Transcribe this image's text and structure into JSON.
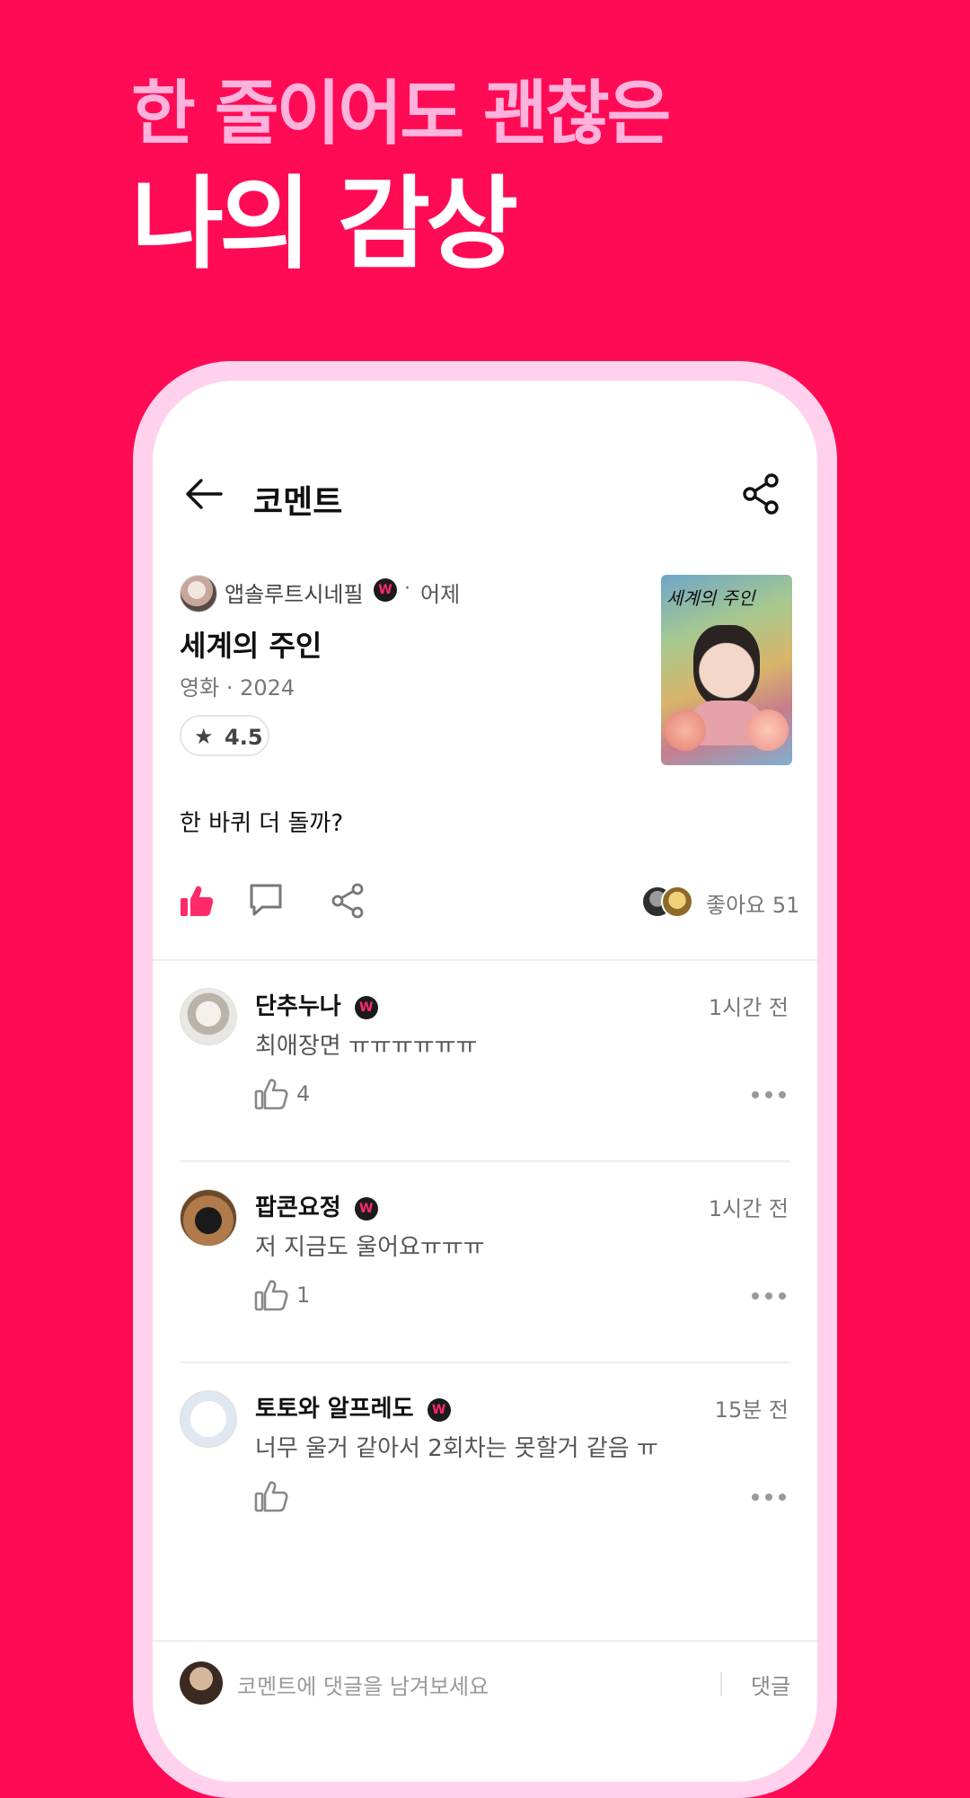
{
  "headline": {
    "line1": "한 줄이어도 괜찮은",
    "line2": "나의 감상"
  },
  "appbar": {
    "title": "코멘트",
    "back_icon": "arrow-left-icon",
    "share_icon": "share-icon"
  },
  "post": {
    "author": "앱솔루트시네필",
    "badge": "W",
    "separator": "·",
    "time": "어제",
    "title": "세계의 주인",
    "category": "영화",
    "year": "2024",
    "rating_star": "★",
    "rating": "4.5",
    "poster_title": "세계의 주인",
    "body": "한 바퀴 더 돌까?",
    "like_label": "좋아요 51",
    "like_active_color": "#ff2a6a"
  },
  "comments": [
    {
      "name": "단추누나",
      "time": "1시간 전",
      "text": "최애장면 ㅠㅠㅠㅠㅠㅠ",
      "likes": "4"
    },
    {
      "name": "팝콘요정",
      "time": "1시간 전",
      "text": "저 지금도 울어요ㅠㅠㅠ",
      "likes": "1"
    },
    {
      "name": "토토와 알프레도",
      "time": "15분 전",
      "text": "너무 울거 같아서 2회차는 못할거 같음 ㅠ",
      "likes": ""
    }
  ],
  "reply_bar": {
    "placeholder": "코멘트에 댓글을 남겨보세요",
    "send_label": "댓글"
  },
  "colors": {
    "background": "#ff0b55",
    "accent_pink": "#ffb3dc",
    "bezel": "#ffd1ec"
  }
}
